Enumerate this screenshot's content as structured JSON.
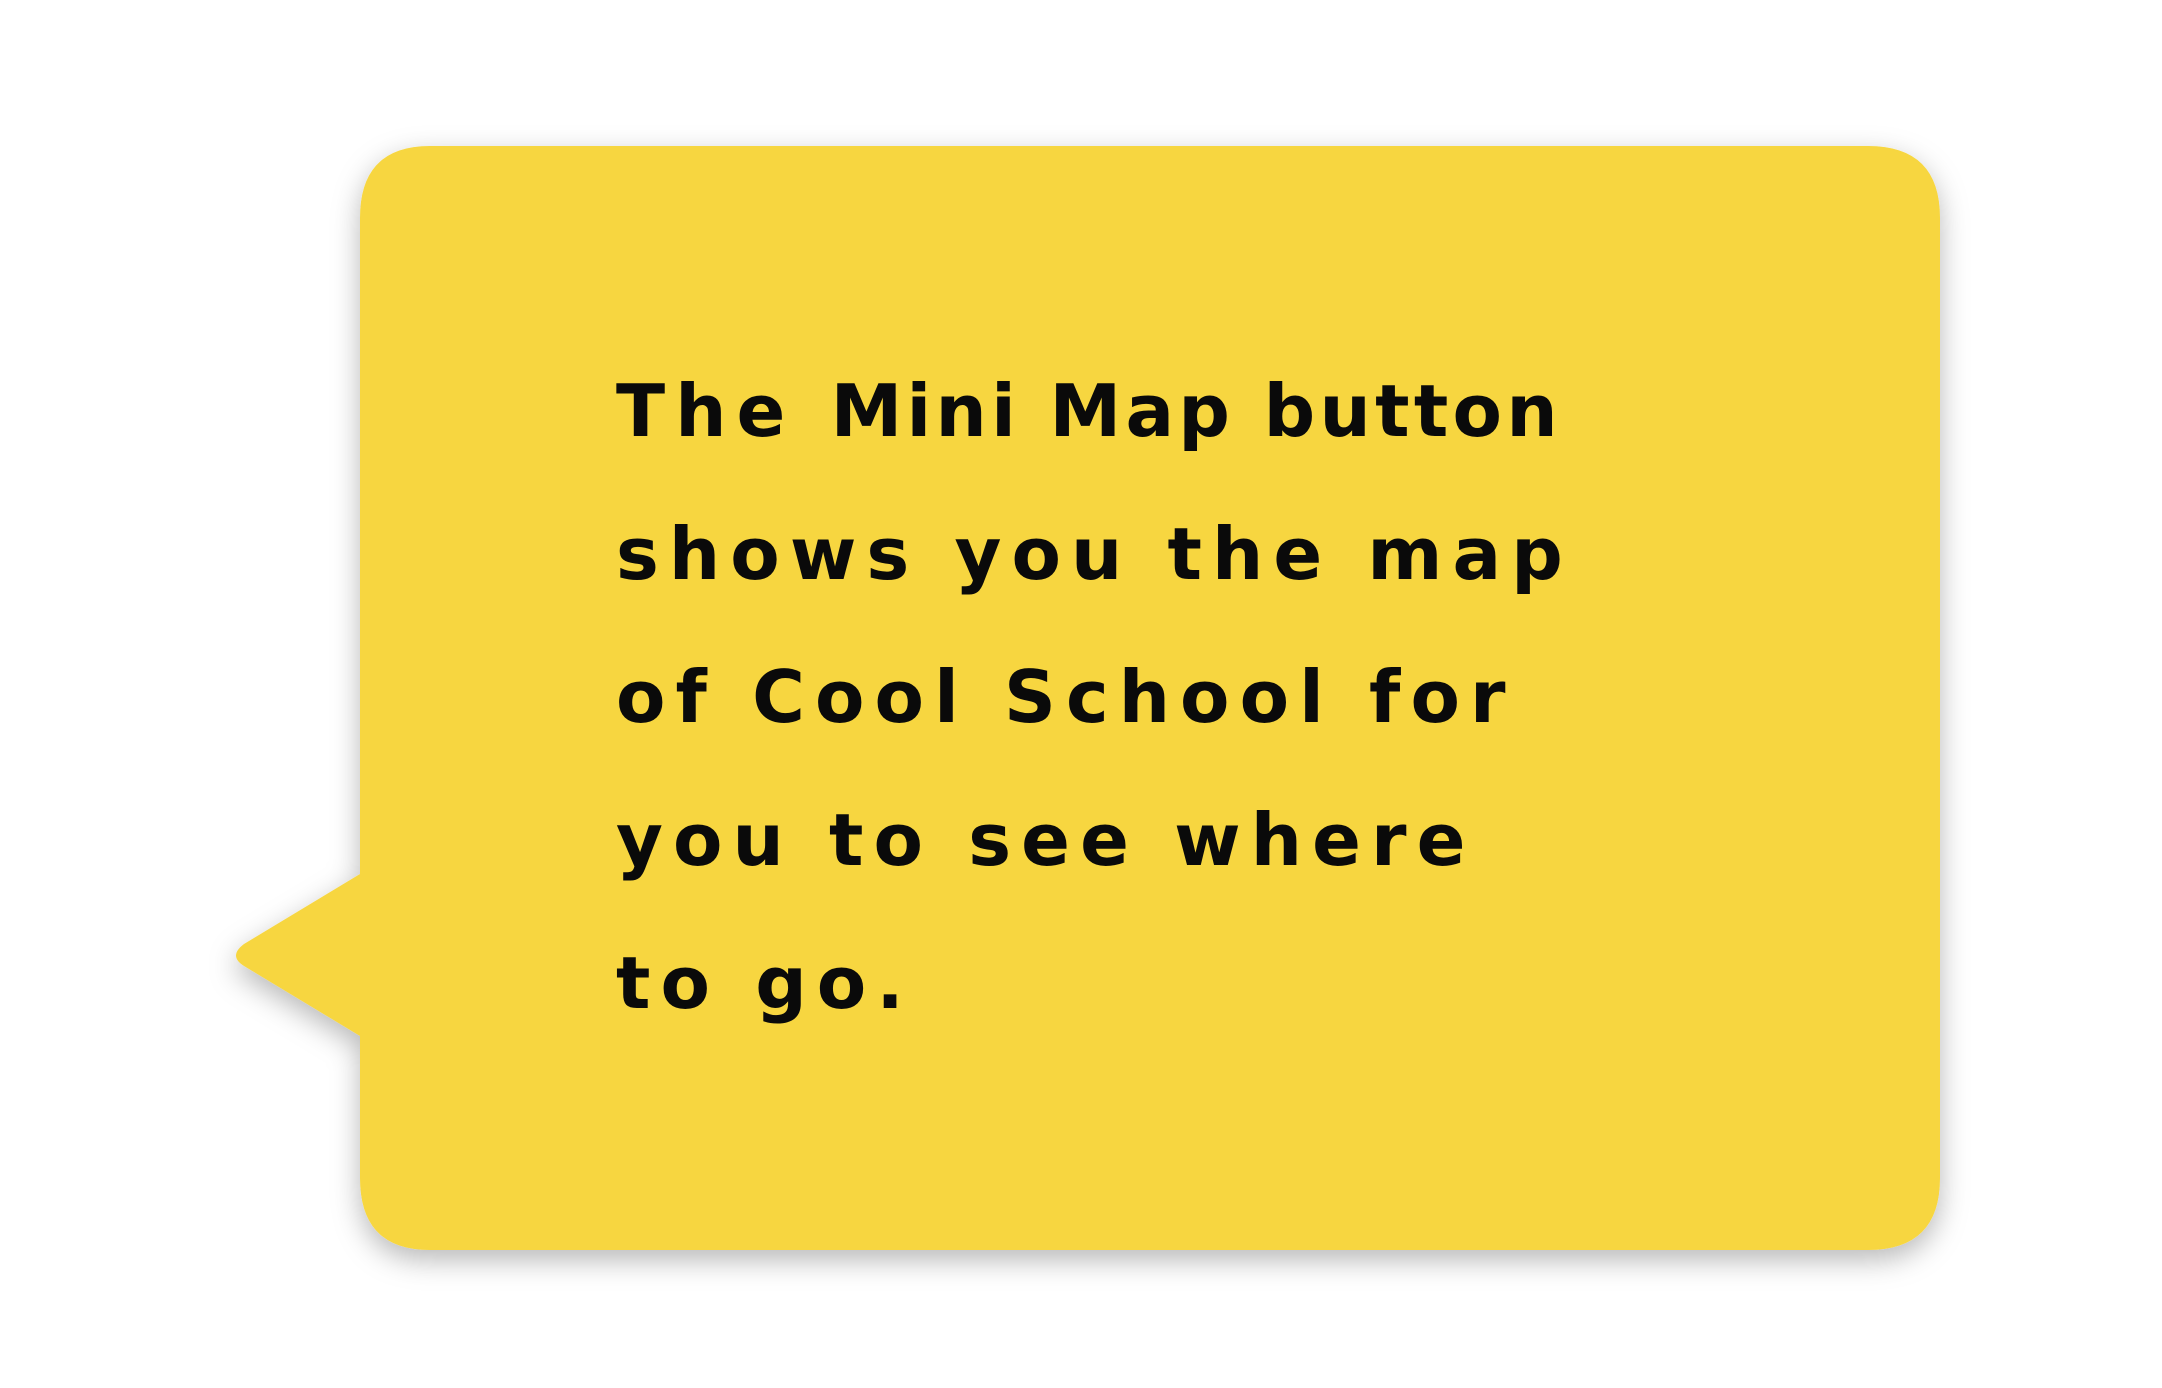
{
  "bubble": {
    "fill_color": "#F7D63F",
    "shadow_color": "#000000"
  },
  "message": {
    "line1_pre": "The ",
    "line1_highlight": "Mini Map button",
    "line2": "shows you the map",
    "line3": "of Cool School for",
    "line4": "you to see where",
    "line5": "to go."
  }
}
